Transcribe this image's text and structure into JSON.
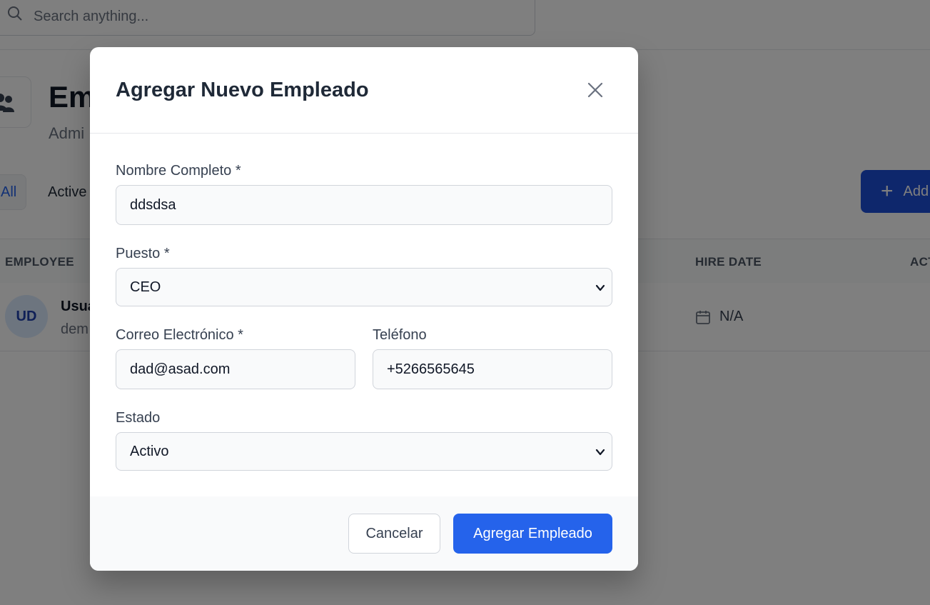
{
  "search": {
    "placeholder": "Search anything..."
  },
  "page": {
    "title": "Em",
    "subtitle": "Admi",
    "filters": {
      "all": "All",
      "active": "Active"
    },
    "add_button": "Add"
  },
  "table": {
    "headers": {
      "employee": "EMPLOYEE",
      "hire_date": "HIRE DATE",
      "actions": "ACT"
    },
    "rows": [
      {
        "initials": "UD",
        "name": "Usua",
        "email": "dem",
        "hire_date": "N/A"
      }
    ]
  },
  "modal": {
    "title": "Agregar Nuevo Empleado",
    "fields": {
      "full_name": {
        "label": "Nombre Completo *",
        "value": "ddsdsa"
      },
      "position": {
        "label": "Puesto *",
        "value": "CEO"
      },
      "email": {
        "label": "Correo Electrónico *",
        "value": "dad@asad.com"
      },
      "phone": {
        "label": "Teléfono",
        "value": "+5266565645"
      },
      "status": {
        "label": "Estado",
        "value": "Activo"
      }
    },
    "cancel_label": "Cancelar",
    "submit_label": "Agregar Empleado"
  },
  "colors": {
    "primary": "#2563eb",
    "primary_dark": "#1d4ed8",
    "overlay": "rgba(0,0,0,0.5)"
  },
  "icons": [
    "search-icon",
    "users-icon",
    "plus-icon",
    "calendar-icon",
    "close-icon",
    "chevron-down-icon"
  ]
}
